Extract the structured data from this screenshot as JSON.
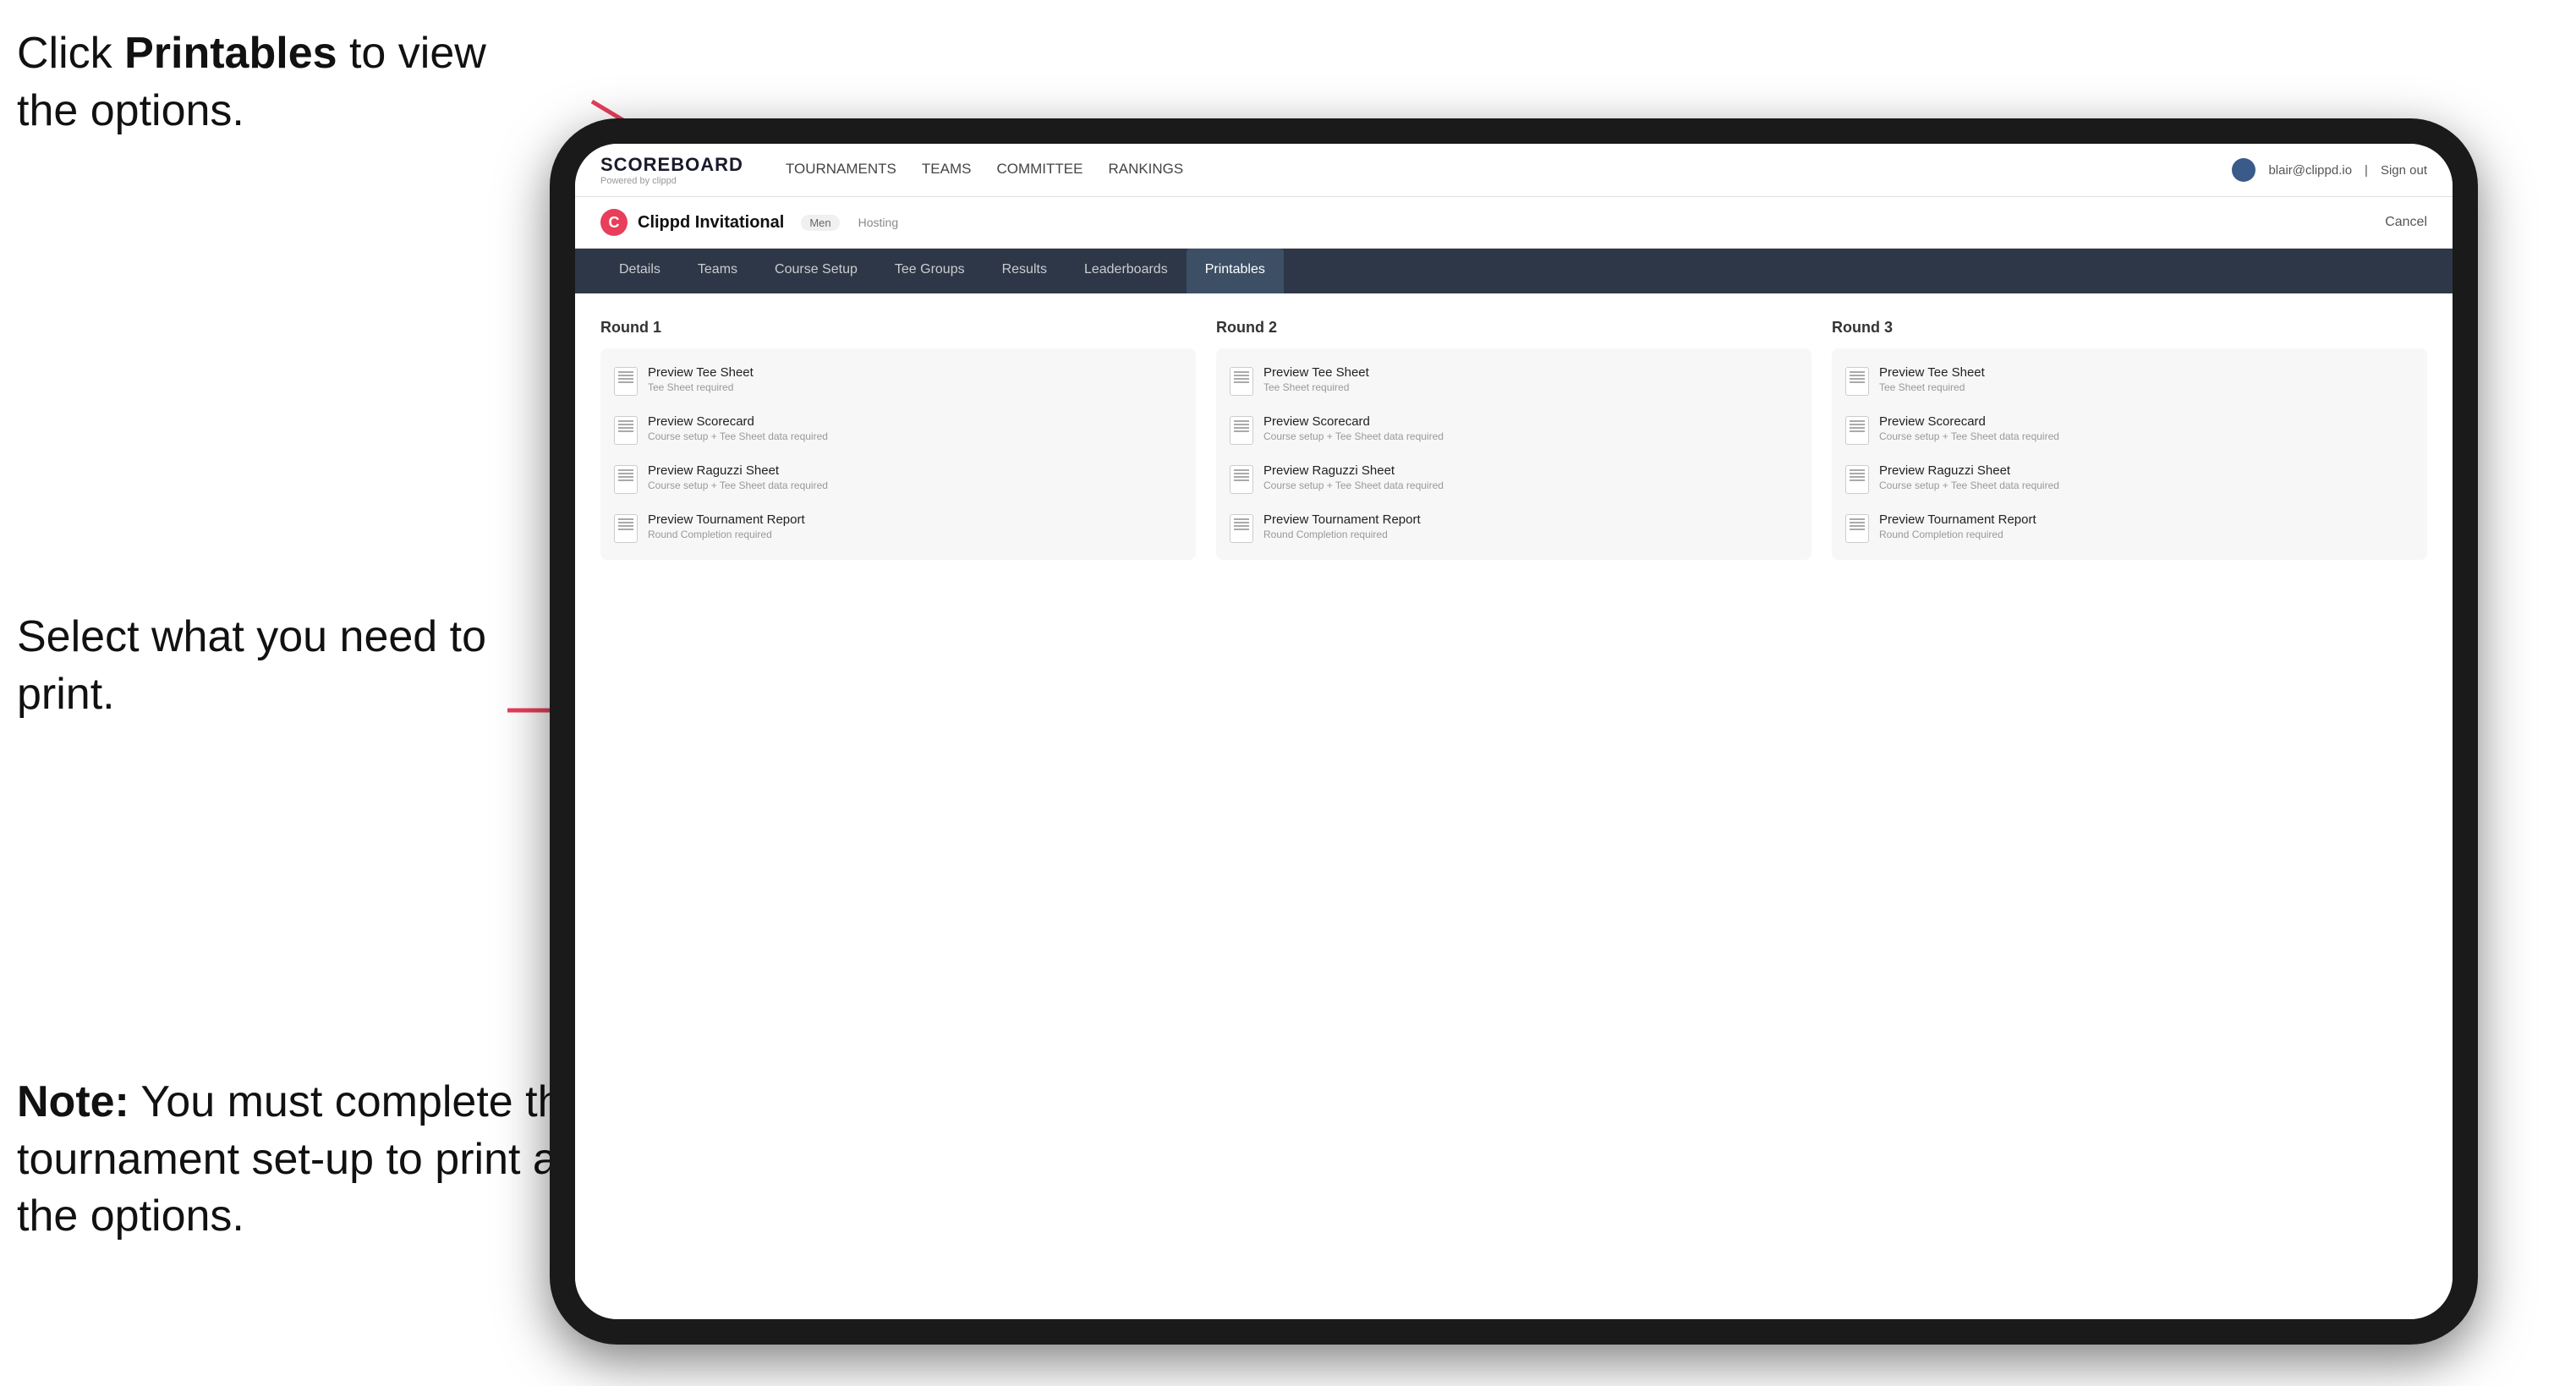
{
  "annotations": {
    "top": {
      "pre": "Click ",
      "bold": "Printables",
      "post": " to view the options."
    },
    "middle": {
      "text": "Select what you need to print."
    },
    "bottom": {
      "pre": "",
      "bold": "Note:",
      "post": " You must complete the tournament set-up to print all the options."
    }
  },
  "nav": {
    "brand": "SCOREBOARD",
    "brand_sub": "Powered by clippd",
    "links": [
      "TOURNAMENTS",
      "TEAMS",
      "COMMITTEE",
      "RANKINGS"
    ],
    "user_email": "blair@clippd.io",
    "sign_out": "Sign out"
  },
  "tournament": {
    "name": "Clippd Invitational",
    "gender": "Men",
    "status": "Hosting",
    "cancel": "Cancel"
  },
  "sub_tabs": [
    "Details",
    "Teams",
    "Course Setup",
    "Tee Groups",
    "Results",
    "Leaderboards",
    "Printables"
  ],
  "active_tab": "Printables",
  "rounds": [
    {
      "title": "Round 1",
      "items": [
        {
          "title": "Preview Tee Sheet",
          "subtitle": "Tee Sheet required"
        },
        {
          "title": "Preview Scorecard",
          "subtitle": "Course setup + Tee Sheet data required"
        },
        {
          "title": "Preview Raguzzi Sheet",
          "subtitle": "Course setup + Tee Sheet data required"
        },
        {
          "title": "Preview Tournament Report",
          "subtitle": "Round Completion required"
        }
      ]
    },
    {
      "title": "Round 2",
      "items": [
        {
          "title": "Preview Tee Sheet",
          "subtitle": "Tee Sheet required"
        },
        {
          "title": "Preview Scorecard",
          "subtitle": "Course setup + Tee Sheet data required"
        },
        {
          "title": "Preview Raguzzi Sheet",
          "subtitle": "Course setup + Tee Sheet data required"
        },
        {
          "title": "Preview Tournament Report",
          "subtitle": "Round Completion required"
        }
      ]
    },
    {
      "title": "Round 3",
      "items": [
        {
          "title": "Preview Tee Sheet",
          "subtitle": "Tee Sheet required"
        },
        {
          "title": "Preview Scorecard",
          "subtitle": "Course setup + Tee Sheet data required"
        },
        {
          "title": "Preview Raguzzi Sheet",
          "subtitle": "Course setup + Tee Sheet data required"
        },
        {
          "title": "Preview Tournament Report",
          "subtitle": "Round Completion required"
        }
      ]
    }
  ],
  "colors": {
    "accent": "#e83e5a",
    "nav_bg": "#2d3748",
    "active_tab_bg": "#3d4f65"
  }
}
